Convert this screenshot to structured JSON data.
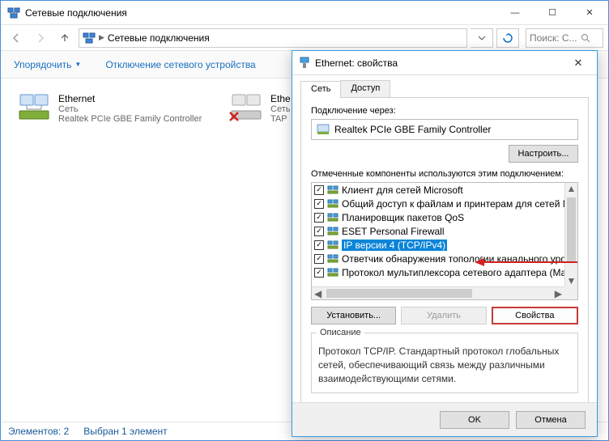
{
  "window": {
    "title": "Сетевые подключения",
    "breadcrumb": "Сетевые подключения",
    "search_placeholder": "Поиск: С..."
  },
  "cmdbar": {
    "organize": "Упорядочить",
    "disable": "Отключение сетевого устройства"
  },
  "connections": [
    {
      "name": "Ethernet",
      "net": "Сеть",
      "device": "Realtek PCIe GBE Family Controller"
    },
    {
      "name": "Ethe",
      "net": "Сеть",
      "device": "TAP"
    }
  ],
  "status": {
    "count": "Элементов: 2",
    "selected": "Выбран 1 элемент"
  },
  "dialog": {
    "title": "Ethernet: свойства",
    "tabs": {
      "net": "Сеть",
      "access": "Доступ"
    },
    "connect_via": "Подключение через:",
    "adapter": "Realtek PCIe GBE Family Controller",
    "configure": "Настроить...",
    "components_label": "Отмеченные компоненты используются этим подключением:",
    "components": [
      {
        "label": "Клиент для сетей Microsoft",
        "checked": true
      },
      {
        "label": "Общий доступ к файлам и принтерам для сетей Mi",
        "checked": true
      },
      {
        "label": "Планировщик пакетов QoS",
        "checked": true
      },
      {
        "label": "ESET Personal Firewall",
        "checked": true
      },
      {
        "label": "IP версии 4 (TCP/IPv4)",
        "checked": true,
        "selected": true
      },
      {
        "label": "Ответчик обнаружения топологии канального уров",
        "checked": true
      },
      {
        "label": "Протокол мультиплексора сетевого адаптера (Ма)",
        "checked": true
      }
    ],
    "install": "Установить...",
    "uninstall": "Удалить",
    "properties": "Свойства",
    "desc_legend": "Описание",
    "desc_text": "Протокол TCP/IP. Стандартный протокол глобальных сетей, обеспечивающий связь между различными взаимодействующими сетями.",
    "ok": "OK",
    "cancel": "Отмена"
  }
}
